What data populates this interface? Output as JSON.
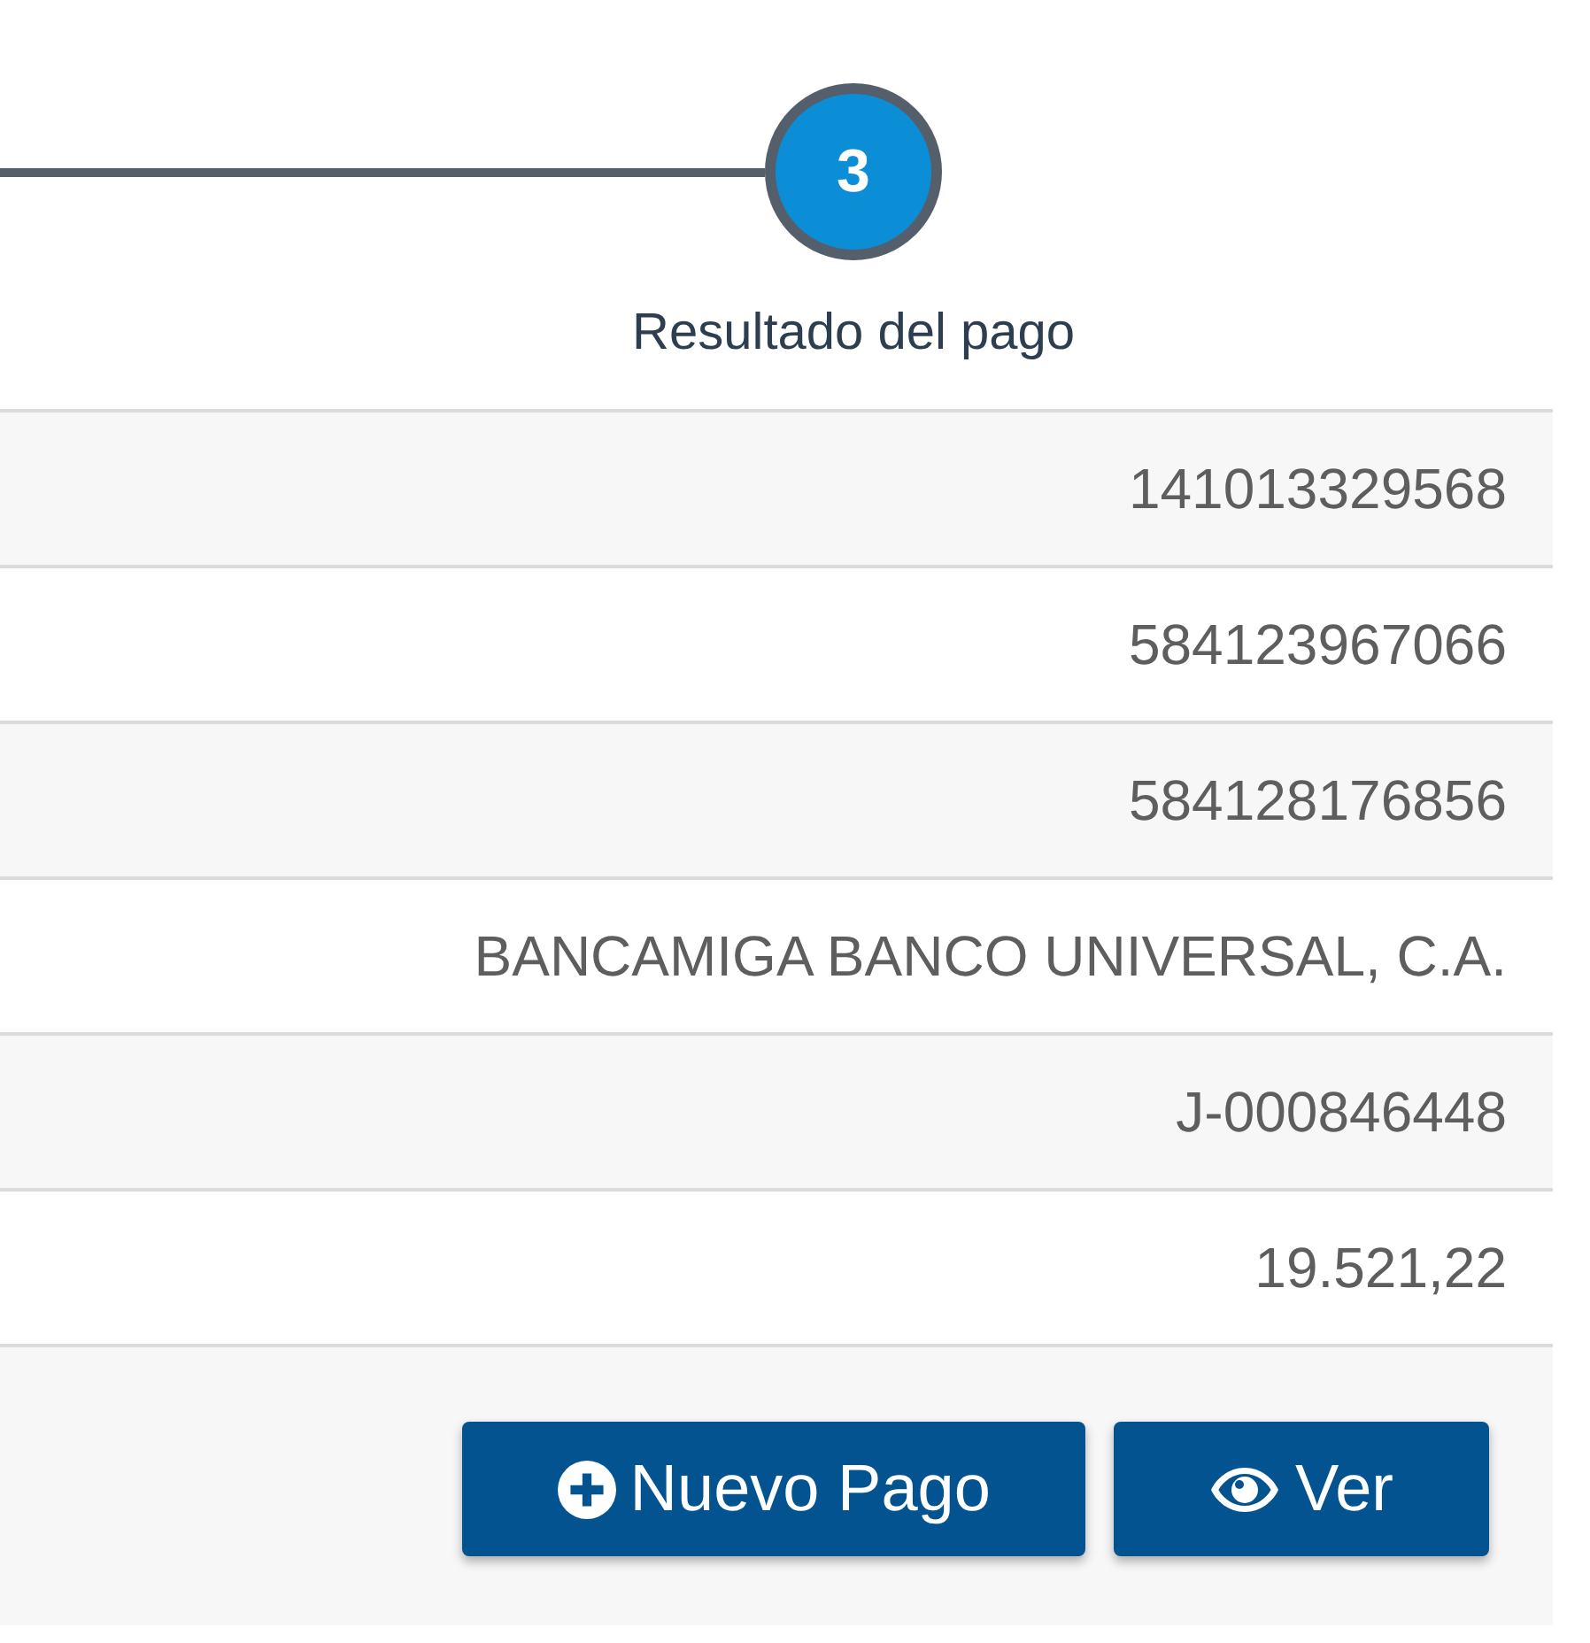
{
  "stepper": {
    "steps": [
      {
        "number": "3",
        "label": "Resultado del pago",
        "active": true
      }
    ]
  },
  "details": {
    "rows": [
      {
        "value": "141013329568"
      },
      {
        "value": "584123967066"
      },
      {
        "value": "584128176856"
      },
      {
        "value": "BANCAMIGA BANCO UNIVERSAL, C.A."
      },
      {
        "value": "J-000846448"
      },
      {
        "value": "19.521,22"
      }
    ]
  },
  "actions": [
    {
      "kind": "add",
      "label": "Nuevo Pago"
    },
    {
      "kind": "view",
      "label": "Ver"
    }
  ]
}
